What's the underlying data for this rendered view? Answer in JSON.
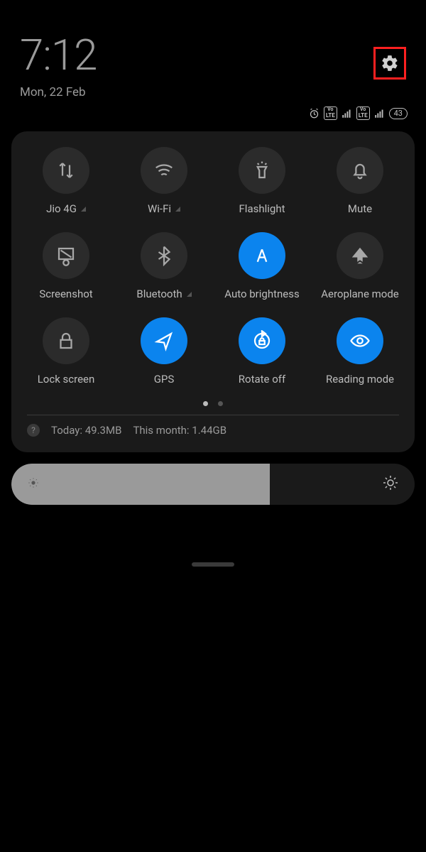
{
  "header": {
    "time": "7:12",
    "date": "Mon, 22 Feb"
  },
  "status": {
    "volte_label": "Vo LTE",
    "battery": "43"
  },
  "tiles": [
    {
      "id": "mobile-data",
      "label": "Jio 4G",
      "active": false,
      "dropdown": true
    },
    {
      "id": "wifi",
      "label": "Wi-Fi",
      "active": false,
      "dropdown": true
    },
    {
      "id": "flashlight",
      "label": "Flashlight",
      "active": false,
      "dropdown": false
    },
    {
      "id": "mute",
      "label": "Mute",
      "active": false,
      "dropdown": false
    },
    {
      "id": "screenshot",
      "label": "Screenshot",
      "active": false,
      "dropdown": false
    },
    {
      "id": "bluetooth",
      "label": "Bluetooth",
      "active": false,
      "dropdown": true
    },
    {
      "id": "auto-brightness",
      "label": "Auto brightness",
      "active": true,
      "dropdown": false
    },
    {
      "id": "aeroplane",
      "label": "Aeroplane mode",
      "active": false,
      "dropdown": false
    },
    {
      "id": "lock-screen",
      "label": "Lock screen",
      "active": false,
      "dropdown": false
    },
    {
      "id": "gps",
      "label": "GPS",
      "active": true,
      "dropdown": false
    },
    {
      "id": "rotate",
      "label": "Rotate off",
      "active": true,
      "dropdown": false
    },
    {
      "id": "reading",
      "label": "Reading mode",
      "active": true,
      "dropdown": false
    }
  ],
  "pages": {
    "current": 0,
    "total": 2
  },
  "data_usage": {
    "today_label": "Today: 49.3MB",
    "month_label": "This month: 1.44GB"
  },
  "brightness": {
    "percent": 64
  },
  "colors": {
    "accent": "#0b84ee",
    "highlight_border": "#ff2020"
  }
}
